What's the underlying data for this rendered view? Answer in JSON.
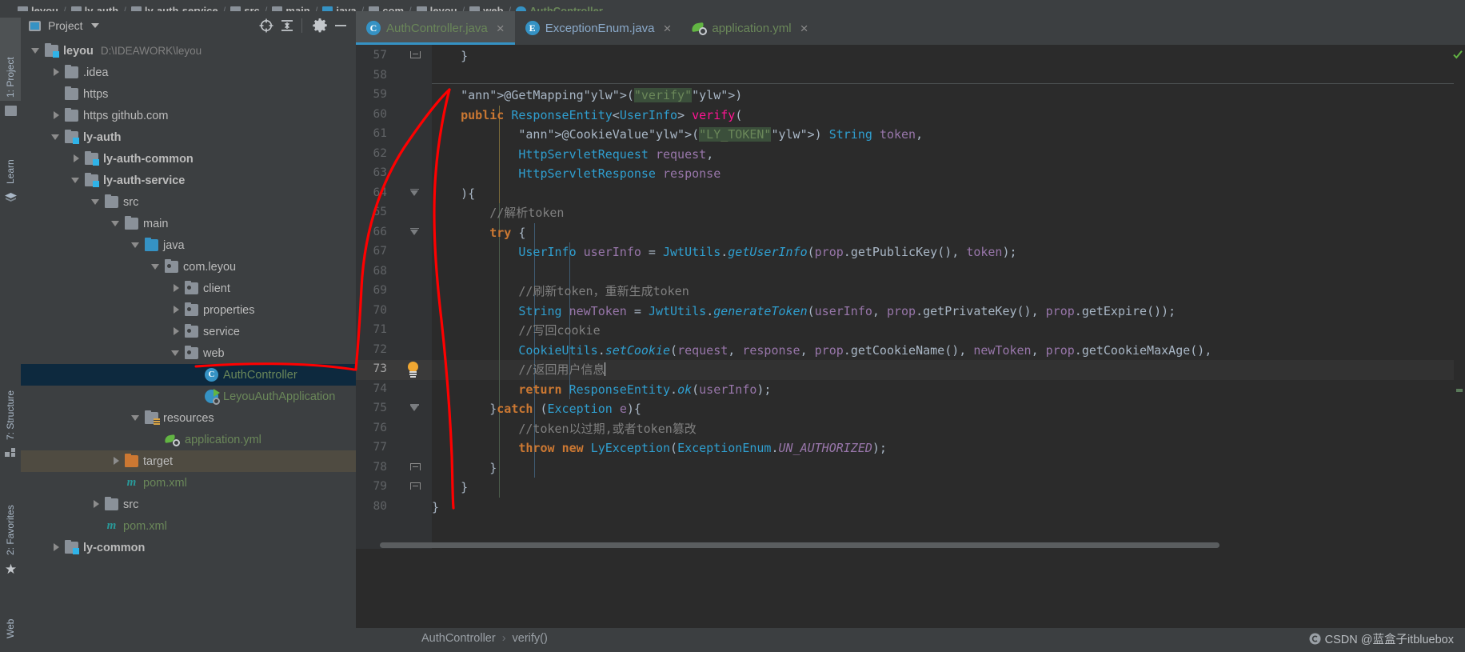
{
  "window": {
    "ide": "IntelliJ IDEA",
    "theme_bg": "#3c3f41",
    "accent": "#3592c4"
  },
  "top_breadcrumb": {
    "items": [
      {
        "label": "leyou",
        "icon": "module-folder-icon",
        "modified": true
      },
      {
        "label": "ly-auth",
        "icon": "module-folder-icon",
        "modified": true
      },
      {
        "label": "ly-auth-service",
        "icon": "module-folder-icon",
        "modified": true
      },
      {
        "label": "src",
        "icon": "folder-icon",
        "modified": false
      },
      {
        "label": "main",
        "icon": "folder-icon",
        "modified": false
      },
      {
        "label": "java",
        "icon": "source-folder-icon",
        "modified": false
      },
      {
        "label": "com",
        "icon": "folder-icon",
        "modified": false
      },
      {
        "label": "leyou",
        "icon": "folder-icon",
        "modified": false
      },
      {
        "label": "web",
        "icon": "folder-icon",
        "modified": false
      },
      {
        "label": "AuthController",
        "icon": "class-icon",
        "modified": false
      }
    ],
    "separator": "/"
  },
  "left_toolbar": {
    "tabs": [
      {
        "label": "1: Project",
        "icon": "project-icon",
        "selected": true
      },
      {
        "label": "Learn",
        "icon": "learn-icon",
        "selected": false
      },
      {
        "label": "7: Structure",
        "icon": "structure-icon",
        "selected": false
      },
      {
        "label": "2: Favorites",
        "icon": "star-icon",
        "selected": false
      },
      {
        "label": "Web",
        "icon": "web-icon",
        "selected": false
      }
    ]
  },
  "project_panel": {
    "title": "Project",
    "dropdown_icon": "chevron-down-icon",
    "window_icon": "project-window-icon",
    "actions": [
      {
        "name": "locate-icon",
        "tooltip": "Select Opened File"
      },
      {
        "name": "collapse-all-icon",
        "tooltip": "Collapse All"
      },
      {
        "name": "settings-gear-icon",
        "tooltip": "Settings"
      },
      {
        "name": "hide-icon",
        "tooltip": "Hide"
      }
    ],
    "tree": [
      {
        "label": "leyou",
        "path": "D:\\IDEAWORK\\leyou",
        "icon": "module-folder-icon",
        "arrow": "down",
        "indent": 0,
        "style": "bold",
        "state": "normal"
      },
      {
        "label": ".idea",
        "path": "",
        "icon": "folder-icon",
        "arrow": "right",
        "indent": 1,
        "style": "normal",
        "state": "normal"
      },
      {
        "label": "https",
        "path": "",
        "icon": "folder-icon",
        "arrow": "none",
        "indent": 1,
        "style": "normal",
        "state": "normal"
      },
      {
        "label": "https github.com",
        "path": "",
        "icon": "folder-icon",
        "arrow": "right",
        "indent": 1,
        "style": "normal",
        "state": "normal"
      },
      {
        "label": "ly-auth",
        "path": "",
        "icon": "module-folder-icon",
        "arrow": "down",
        "indent": 1,
        "style": "bold",
        "state": "normal"
      },
      {
        "label": "ly-auth-common",
        "path": "",
        "icon": "module-folder-icon",
        "arrow": "right",
        "indent": 2,
        "style": "bold",
        "state": "normal"
      },
      {
        "label": "ly-auth-service",
        "path": "",
        "icon": "module-folder-icon",
        "arrow": "down",
        "indent": 2,
        "style": "bold",
        "state": "normal"
      },
      {
        "label": "src",
        "path": "",
        "icon": "folder-icon",
        "arrow": "down",
        "indent": 3,
        "style": "normal",
        "state": "normal"
      },
      {
        "label": "main",
        "path": "",
        "icon": "folder-icon",
        "arrow": "down",
        "indent": 4,
        "style": "normal",
        "state": "normal"
      },
      {
        "label": "java",
        "path": "",
        "icon": "source-folder-icon",
        "arrow": "down",
        "indent": 5,
        "style": "normal",
        "state": "normal"
      },
      {
        "label": "com.leyou",
        "path": "",
        "icon": "package-icon",
        "arrow": "down",
        "indent": 6,
        "style": "normal",
        "state": "normal"
      },
      {
        "label": "client",
        "path": "",
        "icon": "package-icon",
        "arrow": "right",
        "indent": 7,
        "style": "normal",
        "state": "normal"
      },
      {
        "label": "properties",
        "path": "",
        "icon": "package-icon",
        "arrow": "right",
        "indent": 7,
        "style": "normal",
        "state": "normal"
      },
      {
        "label": "service",
        "path": "",
        "icon": "package-icon",
        "arrow": "right",
        "indent": 7,
        "style": "normal",
        "state": "normal"
      },
      {
        "label": "web",
        "path": "",
        "icon": "package-icon",
        "arrow": "down",
        "indent": 7,
        "style": "normal",
        "state": "normal"
      },
      {
        "label": "AuthController",
        "path": "",
        "icon": "class-icon",
        "arrow": "none",
        "indent": 8,
        "style": "green",
        "state": "selected"
      },
      {
        "label": "LeyouAuthApplication",
        "path": "",
        "icon": "run-class-icon",
        "arrow": "none",
        "indent": 8,
        "style": "green",
        "state": "normal"
      },
      {
        "label": "resources",
        "path": "",
        "icon": "resources-folder-icon",
        "arrow": "down",
        "indent": 5,
        "style": "normal",
        "state": "normal"
      },
      {
        "label": "application.yml",
        "path": "",
        "icon": "yaml-icon",
        "arrow": "none",
        "indent": 6,
        "style": "green",
        "state": "normal"
      },
      {
        "label": "target",
        "path": "",
        "icon": "excluded-folder-icon",
        "arrow": "right",
        "indent": 4,
        "style": "normal",
        "state": "target"
      },
      {
        "label": "pom.xml",
        "path": "",
        "icon": "maven-icon",
        "arrow": "none",
        "indent": 4,
        "style": "green",
        "state": "normal"
      },
      {
        "label": "src",
        "path": "",
        "icon": "folder-icon",
        "arrow": "right",
        "indent": 3,
        "style": "normal",
        "state": "normal"
      },
      {
        "label": "pom.xml",
        "path": "",
        "icon": "maven-icon",
        "arrow": "none",
        "indent": 3,
        "style": "green",
        "state": "normal"
      },
      {
        "label": "ly-common",
        "path": "",
        "icon": "module-folder-icon",
        "arrow": "right",
        "indent": 1,
        "style": "bold",
        "state": "normal"
      }
    ]
  },
  "editor": {
    "tabs": [
      {
        "label": "AuthController.java",
        "icon": "java-class-icon",
        "icon_letter": "C",
        "color": "green",
        "active": true,
        "close_icon": "close-icon"
      },
      {
        "label": "ExceptionEnum.java",
        "icon": "java-enum-icon",
        "icon_letter": "E",
        "color": "blue",
        "active": false,
        "close_icon": "close-icon"
      },
      {
        "label": "application.yml",
        "icon": "yaml-icon",
        "icon_letter": "",
        "color": "green",
        "active": false,
        "close_icon": "close-icon"
      }
    ],
    "first_line_number": 57,
    "last_line_number": 80,
    "caret_line": 73,
    "code_lines": [
      {
        "n": 57,
        "text": "    }"
      },
      {
        "n": 58,
        "text": ""
      },
      {
        "n": 59,
        "text": "    @GetMapping(\"verify\")"
      },
      {
        "n": 60,
        "text": "    public ResponseEntity<UserInfo> verify("
      },
      {
        "n": 61,
        "text": "            @CookieValue(\"LY_TOKEN\") String token,"
      },
      {
        "n": 62,
        "text": "            HttpServletRequest request,"
      },
      {
        "n": 63,
        "text": "            HttpServletResponse response"
      },
      {
        "n": 64,
        "text": "    ){"
      },
      {
        "n": 65,
        "text": "        //解析token"
      },
      {
        "n": 66,
        "text": "        try {"
      },
      {
        "n": 67,
        "text": "            UserInfo userInfo = JwtUtils.getUserInfo(prop.getPublicKey(), token);"
      },
      {
        "n": 68,
        "text": ""
      },
      {
        "n": 69,
        "text": "            //刷新token，重新生成token"
      },
      {
        "n": 70,
        "text": "            String newToken = JwtUtils.generateToken(userInfo, prop.getPrivateKey(), prop.getExpire());"
      },
      {
        "n": 71,
        "text": "            //写回cookie"
      },
      {
        "n": 72,
        "text": "            CookieUtils.setCookie(request, response, prop.getCookieName(), newToken, prop.getCookieMaxAge(),"
      },
      {
        "n": 73,
        "text": "            //返回用户信息"
      },
      {
        "n": 74,
        "text": "            return ResponseEntity.ok(userInfo);"
      },
      {
        "n": 75,
        "text": "        }catch (Exception e){"
      },
      {
        "n": 76,
        "text": "            //token以过期,或者token篡改"
      },
      {
        "n": 77,
        "text": "            throw new LyException(ExceptionEnum.UN_AUTHORIZED);"
      },
      {
        "n": 78,
        "text": "        }"
      },
      {
        "n": 79,
        "text": "    }"
      },
      {
        "n": 80,
        "text": "}"
      }
    ]
  },
  "status_bar": {
    "breadcrumb": [
      "AuthController",
      "verify()"
    ],
    "separator": "›",
    "watermark": "CSDN @蓝盒子itbluebox",
    "watermark_icon": "csdn-logo-icon"
  },
  "annotation": {
    "color": "#ff0000",
    "description": "hand-drawn red arrow from AuthController tree node to line 73"
  }
}
